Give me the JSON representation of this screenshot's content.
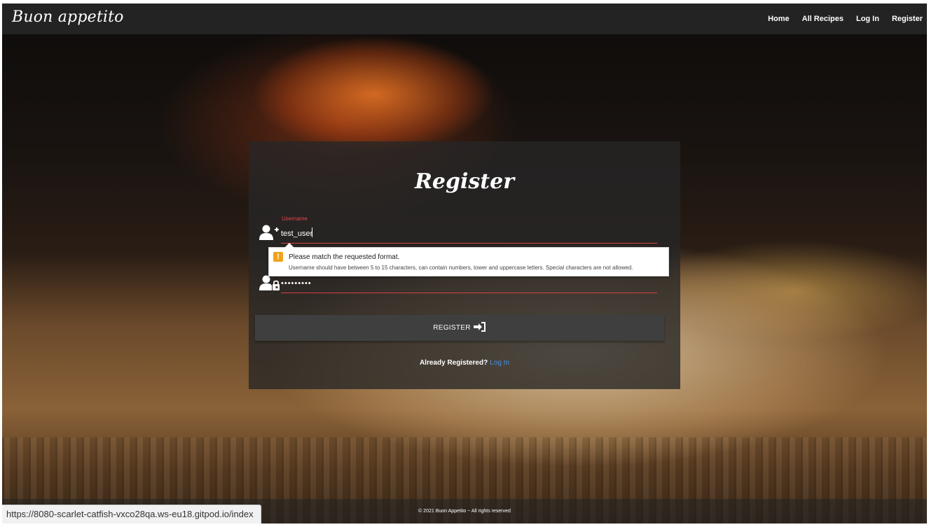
{
  "navbar": {
    "brand": "Buon appetito",
    "links": [
      "Home",
      "All Recipes",
      "Log In",
      "Register"
    ]
  },
  "form": {
    "title": "Register",
    "username_label": "Username",
    "username_value": "test_user",
    "password_value": "•••••••••",
    "submit_label": "REGISTER",
    "already_text": "Already Registered?",
    "login_link": "Log In"
  },
  "validation": {
    "title": "Please match the requested format.",
    "message": "Username should have between 5 to 15 characters, can contain numbers, lower and uppercase letters. Special characters are not allowed."
  },
  "footer": {
    "text": "© 2021 Buon Appetito ~ All rights reserved"
  },
  "statusbar": {
    "url": "https://8080-scarlet-catfish-vxco28qa.ws-eu18.gitpod.io/index"
  },
  "colors": {
    "navbar_bg": "#232323",
    "accent_error": "#d9404a",
    "link": "#4a90e2",
    "warning": "#f0a21a"
  },
  "icons": {
    "username": "user-plus-icon",
    "password": "user-lock-icon",
    "submit": "sign-in-icon",
    "warning": "warning-icon"
  }
}
